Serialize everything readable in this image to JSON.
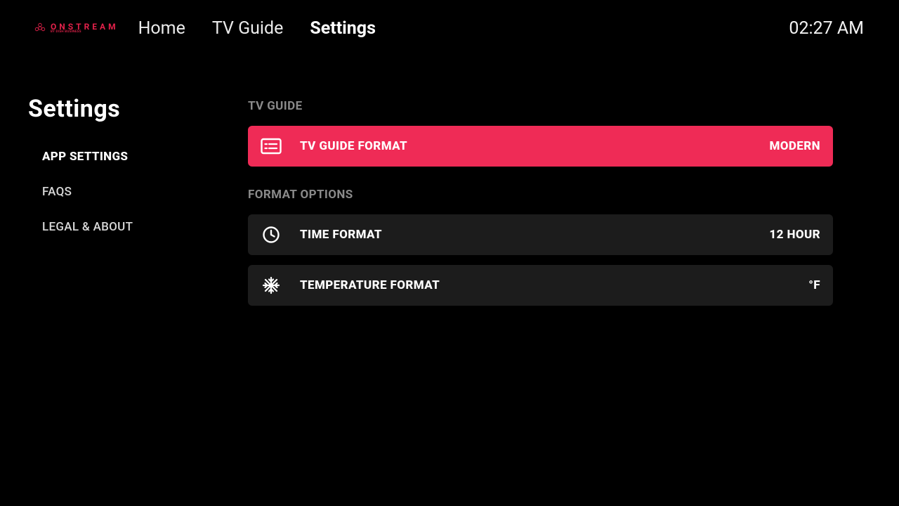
{
  "logo": {
    "word": "ONSTREAM",
    "sub": "BY DISH BUSINESS"
  },
  "nav": {
    "home": "Home",
    "guide": "TV Guide",
    "settings": "Settings"
  },
  "clock": "02:27 AM",
  "page_title": "Settings",
  "sidebar": {
    "items": [
      {
        "label": "APP SETTINGS"
      },
      {
        "label": "FAQS"
      },
      {
        "label": "LEGAL & ABOUT"
      }
    ]
  },
  "sections": {
    "tv_guide": {
      "title": "TV GUIDE",
      "row": {
        "label": "TV GUIDE FORMAT",
        "value": "MODERN"
      }
    },
    "format_options": {
      "title": "FORMAT OPTIONS",
      "time": {
        "label": "TIME FORMAT",
        "value": "12 HOUR"
      },
      "temp": {
        "label": "TEMPERATURE FORMAT",
        "value": "°F"
      }
    }
  }
}
